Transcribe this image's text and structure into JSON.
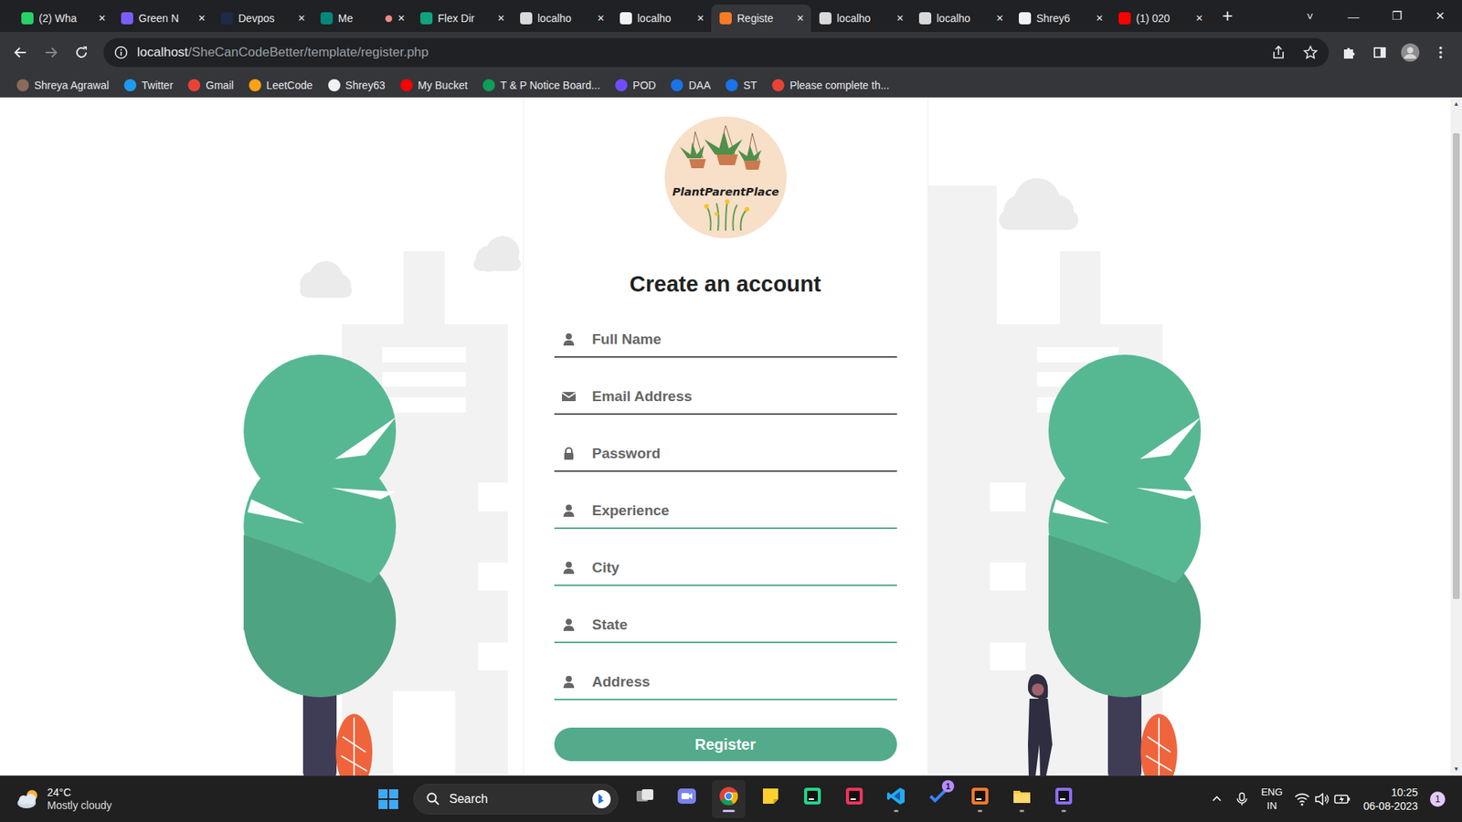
{
  "window": {
    "controls": [
      "—",
      "❐",
      "✕"
    ]
  },
  "tabs": [
    {
      "label": "(2) Wha",
      "selected": false,
      "recording": false,
      "color": "#25d366"
    },
    {
      "label": "Green N",
      "selected": false,
      "recording": false,
      "color": "#7b5cff"
    },
    {
      "label": "Devpos",
      "selected": false,
      "recording": false,
      "color": "#1e2a4a"
    },
    {
      "label": "Me",
      "selected": false,
      "recording": true,
      "color": "#00897b"
    },
    {
      "label": "Flex Dir",
      "selected": false,
      "recording": false,
      "color": "#10a37f"
    },
    {
      "label": "localho",
      "selected": false,
      "recording": false,
      "color": "#d9d9d9"
    },
    {
      "label": "localho",
      "selected": false,
      "recording": false,
      "color": "#f1f1f1"
    },
    {
      "label": "Registe",
      "selected": true,
      "recording": false,
      "color": "#fb7a24"
    },
    {
      "label": "localho",
      "selected": false,
      "recording": false,
      "color": "#d9d9d9"
    },
    {
      "label": "localho",
      "selected": false,
      "recording": false,
      "color": "#d9d9d9"
    },
    {
      "label": "Shrey6",
      "selected": false,
      "recording": false,
      "color": "#f1f1f1"
    },
    {
      "label": "(1) 020",
      "selected": false,
      "recording": false,
      "color": "#ff0000"
    }
  ],
  "tab_close": "✕",
  "new_tab": "+",
  "tab_search": "˅",
  "navigation": {
    "back_enabled": true,
    "forward_enabled": false
  },
  "address": {
    "host": "localhost",
    "path": "/SheCanCodeBetter/template/register.php",
    "bookmarked": false
  },
  "bookmarks": [
    {
      "label": "Shreya Agrawal",
      "color": "#8a6a5a"
    },
    {
      "label": "Twitter",
      "color": "#1d9bf0"
    },
    {
      "label": "Gmail",
      "color": "#ea4335"
    },
    {
      "label": "LeetCode",
      "color": "#ffa116"
    },
    {
      "label": "Shrey63",
      "color": "#f1f1f1"
    },
    {
      "label": "My Bucket",
      "color": "#ff0000"
    },
    {
      "label": "T & P Notice Board...",
      "color": "#0f9d58"
    },
    {
      "label": "POD",
      "color": "#6f4cff"
    },
    {
      "label": "DAA",
      "color": "#1a73e8"
    },
    {
      "label": "ST",
      "color": "#1a73e8"
    },
    {
      "label": "Please complete th...",
      "color": "#ea4335"
    }
  ],
  "page": {
    "logo": {
      "text": "PlantParentPlace"
    },
    "heading": "Create an account",
    "fields": [
      {
        "placeholder": "Full Name",
        "kind": "user",
        "color": "#555555"
      },
      {
        "placeholder": "Email Address",
        "kind": "email",
        "color": "#555555"
      },
      {
        "placeholder": "Password",
        "kind": "password",
        "color": "#555555"
      },
      {
        "placeholder": "Experience",
        "kind": "user",
        "color": "#53ab8b"
      },
      {
        "placeholder": "City",
        "kind": "user",
        "color": "#53ab8b"
      },
      {
        "placeholder": "State",
        "kind": "user",
        "color": "#53ab8b"
      },
      {
        "placeholder": "Address",
        "kind": "user",
        "color": "#53ab8b"
      }
    ],
    "button": "Register"
  },
  "scrollbar": {
    "up": "▲",
    "down": "▼",
    "level": 0.74
  },
  "taskbar": {
    "weather": {
      "temperature": "24°C",
      "condition": "Mostly cloudy"
    },
    "search": {
      "placeholder": "Search"
    },
    "apps": [
      {
        "kind": "taskview",
        "color": "#e6e6e6",
        "running": false,
        "active": false,
        "badge": ""
      },
      {
        "kind": "meet",
        "color": "#7b83eb",
        "running": false,
        "active": false,
        "badge": ""
      },
      {
        "kind": "chrome",
        "color": "#4285f4",
        "running": true,
        "active": true,
        "badge": ""
      },
      {
        "kind": "notes",
        "color": "#ffd02f",
        "running": false,
        "active": false,
        "badge": ""
      },
      {
        "kind": "pycharm",
        "color": "#21d789",
        "running": false,
        "active": false,
        "badge": ""
      },
      {
        "kind": "intellij",
        "color": "#fe315d",
        "running": false,
        "active": false,
        "badge": ""
      },
      {
        "kind": "vscode",
        "color": "#23a9f2",
        "running": true,
        "active": false,
        "badge": ""
      },
      {
        "kind": "todo",
        "color": "#3b82f6",
        "running": false,
        "active": false,
        "badge": "1"
      },
      {
        "kind": "xampp",
        "color": "#fb7a24",
        "running": true,
        "active": false,
        "badge": ""
      },
      {
        "kind": "files",
        "color": "#ffc83d",
        "running": true,
        "active": false,
        "badge": ""
      },
      {
        "kind": "clipboard",
        "color": "#8c6cff",
        "running": true,
        "active": false,
        "badge": ""
      }
    ],
    "tray": {
      "language": "ENG",
      "region": "IN",
      "time": "10:25",
      "date": "06-08-2023",
      "notifications": "1"
    }
  }
}
